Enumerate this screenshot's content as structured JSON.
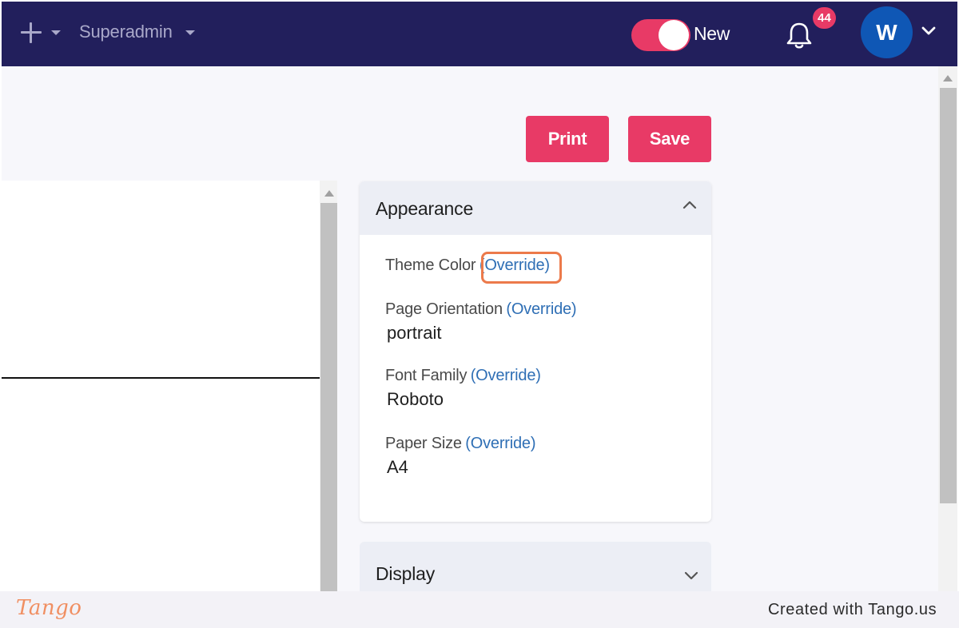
{
  "header": {
    "role_label": "Superadmin",
    "toggle_label": "New",
    "notification_count": "44",
    "avatar_initial": "W"
  },
  "actions": {
    "print_label": "Print",
    "save_label": "Save"
  },
  "appearance": {
    "title": "Appearance",
    "override_label": "(Override)",
    "fields": [
      {
        "label": "Theme Color",
        "value": ""
      },
      {
        "label": "Page Orientation",
        "value": "portrait"
      },
      {
        "label": "Font Family",
        "value": "Roboto"
      },
      {
        "label": "Paper Size",
        "value": "A4"
      }
    ]
  },
  "display": {
    "title": "Display"
  },
  "footer": {
    "logo_text": "Tango",
    "created_text": "Created with Tango.us"
  },
  "colors": {
    "topbar": "#221f5c",
    "accent": "#e83a66",
    "link": "#2f6fb5",
    "highlight": "#ec7a4b",
    "avatar": "#0f57b5"
  },
  "icons": {
    "create": "plus-icon",
    "notifications": "bell-icon",
    "expand": "chevron-down-icon",
    "collapse": "chevron-up-icon"
  }
}
